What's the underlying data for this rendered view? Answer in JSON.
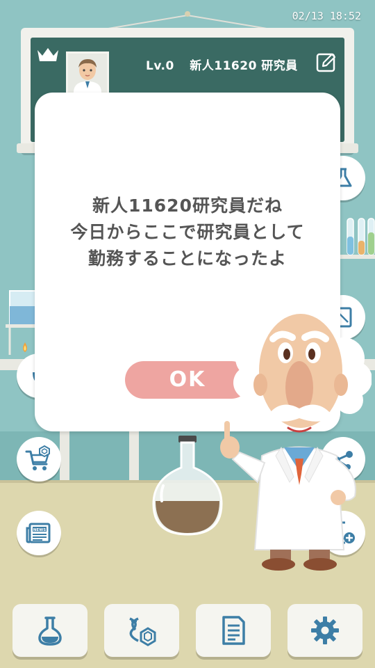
{
  "status_bar": {
    "datetime": "02/13 18:52"
  },
  "player": {
    "level": "Lv.0",
    "name": "新人11620 研究員"
  },
  "dialog": {
    "lines": [
      "新人11620研究員だね",
      "今日からここで研究員として",
      "勤務することになったよ"
    ],
    "ok_label": "OK"
  },
  "icons": {
    "crown": "crown-icon",
    "edit": "pencil-edit-icon",
    "shop": "cart-icon",
    "news": "news-icon",
    "flask": "flask-icon",
    "dna": "dna-molecule-icon",
    "notes": "document-icon",
    "settings": "gear-icon"
  },
  "side_labels": {
    "news_badge": "NEWS"
  },
  "colors": {
    "wall": "#8fc4c3",
    "board": "#3a6a63",
    "ok_button": "#eea5a1",
    "icon_blue": "#3d7ea6"
  }
}
